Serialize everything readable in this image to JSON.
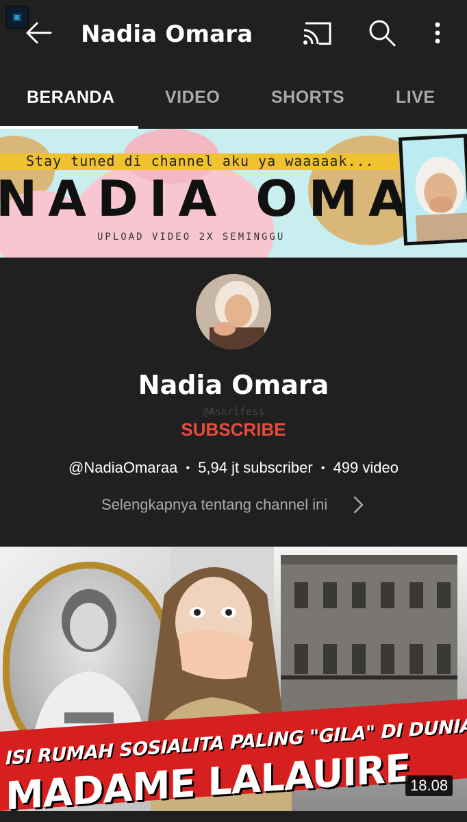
{
  "header": {
    "title": "Nadia Omara",
    "icons": {
      "back": "arrow-left-icon",
      "cast": "cast-icon",
      "search": "search-icon",
      "more": "more-vert-icon"
    }
  },
  "tabs": [
    {
      "label": "BERANDA",
      "active": true
    },
    {
      "label": "VIDEO",
      "active": false
    },
    {
      "label": "SHORTS",
      "active": false
    },
    {
      "label": "LIVE",
      "active": false
    }
  ],
  "banner": {
    "tagline": "Stay tuned di channel aku ya waaaaak...",
    "name": "NADIA OMARA",
    "subline": "UPLOAD VIDEO 2X SEMINGGU"
  },
  "channel": {
    "name": "Nadia Omara",
    "watermark": "@Askrlfess",
    "subscribe_label": "SUBSCRIBE",
    "handle": "@NadiaOmaraa",
    "subscribers": "5,94 jt subscriber",
    "videos": "499 video",
    "separator": "•",
    "about_label": "Selengkapnya tentang channel ini"
  },
  "featured_video": {
    "title_line1": "ISI RUMAH SOSIALITA PALING \"GILA\" DI DUNIA",
    "title_line2": "MADAME LALAUIRE",
    "duration": "18.08"
  },
  "colors": {
    "background": "#202020",
    "subscribe": "#e94b3c",
    "muted_text": "#aaaaaa",
    "thumb_red": "#d62020"
  }
}
